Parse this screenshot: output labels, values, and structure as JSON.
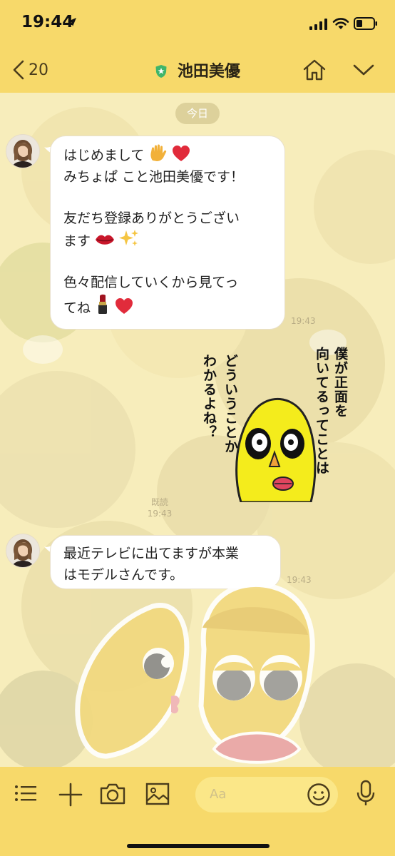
{
  "status_bar": {
    "time": "19:44",
    "icons": [
      "location-arrow-icon",
      "cellular-signal-icon",
      "wifi-icon",
      "battery-icon"
    ]
  },
  "header": {
    "back_count": "20",
    "title": "池田美優",
    "verified_icon": "official-shield-icon",
    "actions": [
      "home-icon",
      "chevron-down-icon"
    ]
  },
  "chat": {
    "date_label": "今日",
    "messages": [
      {
        "sender": "池田美優",
        "lines": [
          "はじめまして",
          "みちょぱ こと池田美優です！",
          "",
          "友だち登録ありがとうござい",
          "ます",
          "",
          "色々配信していくから見てっ",
          "てね"
        ],
        "emojis": [
          "raised-hand-emoji",
          "red-heart-emoji",
          "lips-emoji",
          "sparkles-emoji",
          "lipstick-emoji",
          "red-heart-emoji"
        ],
        "time": "19:43"
      },
      {
        "sender": "me",
        "type": "sticker",
        "sticker_text": [
          "僕が正面を",
          "向いてるってことは",
          "どういうことか",
          "わかるよね？"
        ],
        "read_label": "既読",
        "time": "19:43"
      },
      {
        "sender": "池田美優",
        "lines": [
          "最近テレビに出てますが本業",
          "はモデルさんです。"
        ],
        "time": "19:43"
      }
    ]
  },
  "input_bar": {
    "placeholder": "Aa",
    "icons": [
      "menu-icon",
      "plus-icon",
      "camera-icon",
      "image-icon",
      "emoji-icon",
      "microphone-icon"
    ]
  },
  "colors": {
    "header_bg": "#f7d96a",
    "chat_bg": "#f7edbb",
    "bubble_bg": "#ffffff",
    "verified": "#3fb56a"
  }
}
